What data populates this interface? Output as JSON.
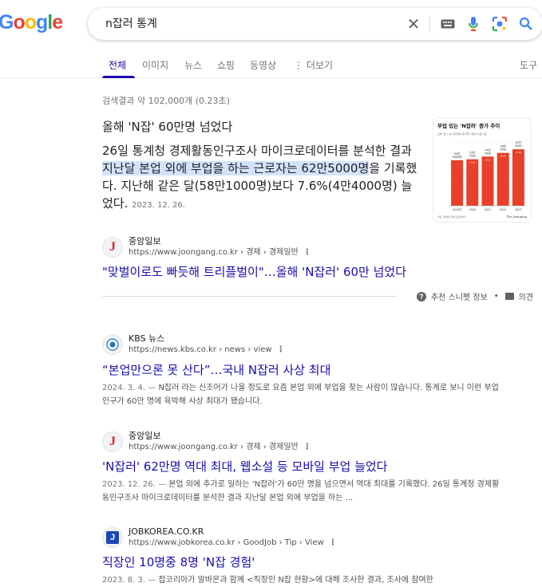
{
  "logo": [
    "G",
    "o",
    "o",
    "g",
    "l",
    "e"
  ],
  "search": {
    "query": "n잡러 통계"
  },
  "tabs": [
    {
      "label": "전체",
      "active": true
    },
    {
      "label": "이미지"
    },
    {
      "label": "뉴스"
    },
    {
      "label": "쇼핑"
    },
    {
      "label": "동영상"
    },
    {
      "label": "⋮ 더보기"
    },
    {
      "label": "도구"
    }
  ],
  "result_stats": "검색결과 약 102,000개 (0.23초)",
  "featured": {
    "title": "올해 'N잡' 60만명 넘었다",
    "body_pre": "26일 통계청 경제활동인구조사 마이크로데이터를 분석한 결과 ",
    "body_hl": "지난달 본업 외에 부업을 하는 근로자는 62만5000명",
    "body_post": "을 기록했다. 지난해 같은 달(58만1000명)보다 7.6%(4만4000명) 늘었다.",
    "date": "2023. 12. 26.",
    "source_name": "중앙일보",
    "source_url": "https://www.joongang.co.kr › 경제 › 경제일반",
    "link_title": "\"맞벌이로도 빠듯해 트리플벌이\"…올해 'N잡러' 60만 넘었다",
    "footer_info": "추천 스니펫 정보",
    "footer_feedback": "의견"
  },
  "thumb_chart": {
    "title": "부업 있는 'N잡러' 증가 추이",
    "subtitle": "단위: 명, (  )는 전년대비 증가율 / 매년 11월 기준",
    "categories": [
      "2019년",
      "2020",
      "2021",
      "2022",
      "2023"
    ],
    "values": [
      50,
      51,
      54,
      58,
      62
    ],
    "labels": [
      "50만\n9000명",
      "51만\n7000",
      "54만\n3000",
      "58만\n1000",
      "62만\n5000"
    ],
    "growth": [
      "",
      "(1.6)",
      "(5.0)",
      "(6.9)",
      "(7.6)"
    ],
    "footer_left": "자료: 통계청 마이크로데이터",
    "footer_right": "The JoongAng",
    "bar_color": "#e8402a"
  },
  "results": [
    {
      "source_name": "KBS 뉴스",
      "source_url": "https://news.kbs.co.kr › news › view",
      "title": "“본업만으론 못 산다”…국내 N잡러 사상 최대",
      "date": "2024. 3. 4.",
      "desc": "N잡러 라는 신조어가 나올 정도로 요즘 본업 외에 부업을 찾는 사람이 많습니다. 통계로 보니 이런 부업 인구가 60만 명에 육박해 사상 최대가 됐습니다."
    },
    {
      "source_name": "중앙일보",
      "source_url": "https://www.joongang.co.kr › 경제 › 경제일반",
      "title": "'N잡러' 62만명 역대 최대, 웹소설 등 모바일 부업 늘었다",
      "date": "2023. 12. 26.",
      "desc": "본업 외에 추가로 일하는 'N잡러'가 60만 명을 넘으면서 역대 최대를 기록했다. 26일 통계청 경제활동인구조사 마이크로데이터를 분석한 결과 지난달 본업 외에 부업을 하는 ..."
    },
    {
      "source_name": "JOBKOREA.CO.KR",
      "source_url": "https://www.jobkorea.co.kr › GoodJob › Tip › View",
      "title": "직장인 10명중 8명 'N잡 경험'",
      "date": "2023. 8. 3.",
      "desc": "잡코리아가 알바몬과 함께 <직장인 N잡 현황>에 대해 조사한 결과, 조사에 참여한"
    }
  ],
  "colors": {
    "link": "#1a0dab",
    "text": "#202124",
    "muted": "#70757a",
    "highlight": "#d3e3fd"
  }
}
